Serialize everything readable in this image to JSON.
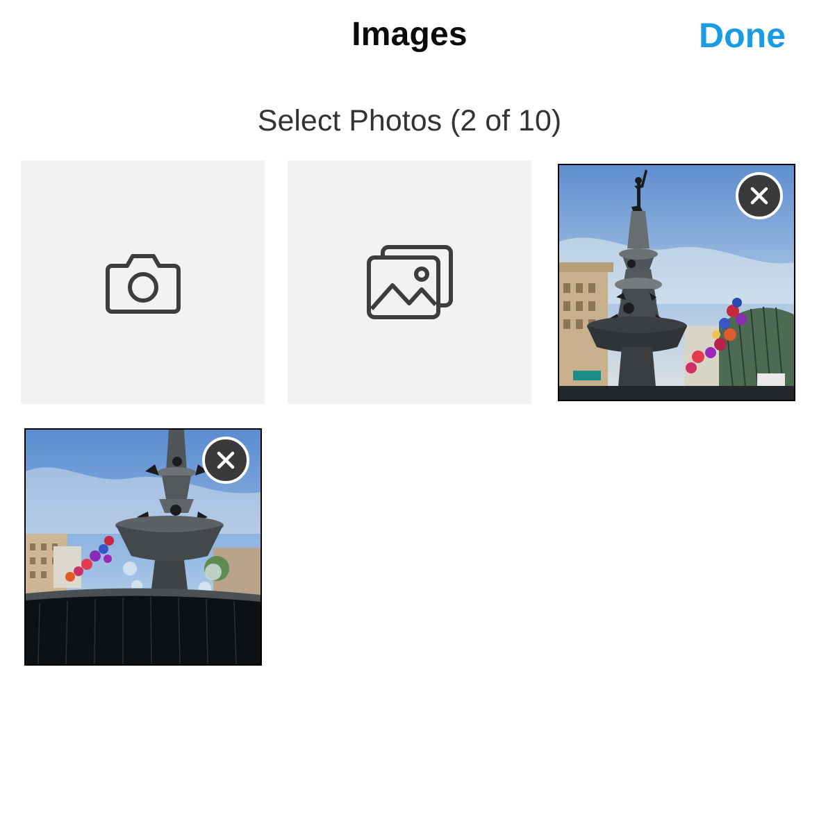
{
  "header": {
    "title": "Images",
    "done_label": "Done"
  },
  "picker": {
    "subtitle": "Select Photos (2 of 10)",
    "selected_count": 2,
    "max_count": 10
  },
  "tiles": {
    "camera_icon": "camera-icon",
    "gallery_icon": "gallery-icon"
  },
  "colors": {
    "accent": "#1a9be6",
    "tile_bg": "#f2f2f5",
    "remove_bg": "#3a3a3c"
  }
}
